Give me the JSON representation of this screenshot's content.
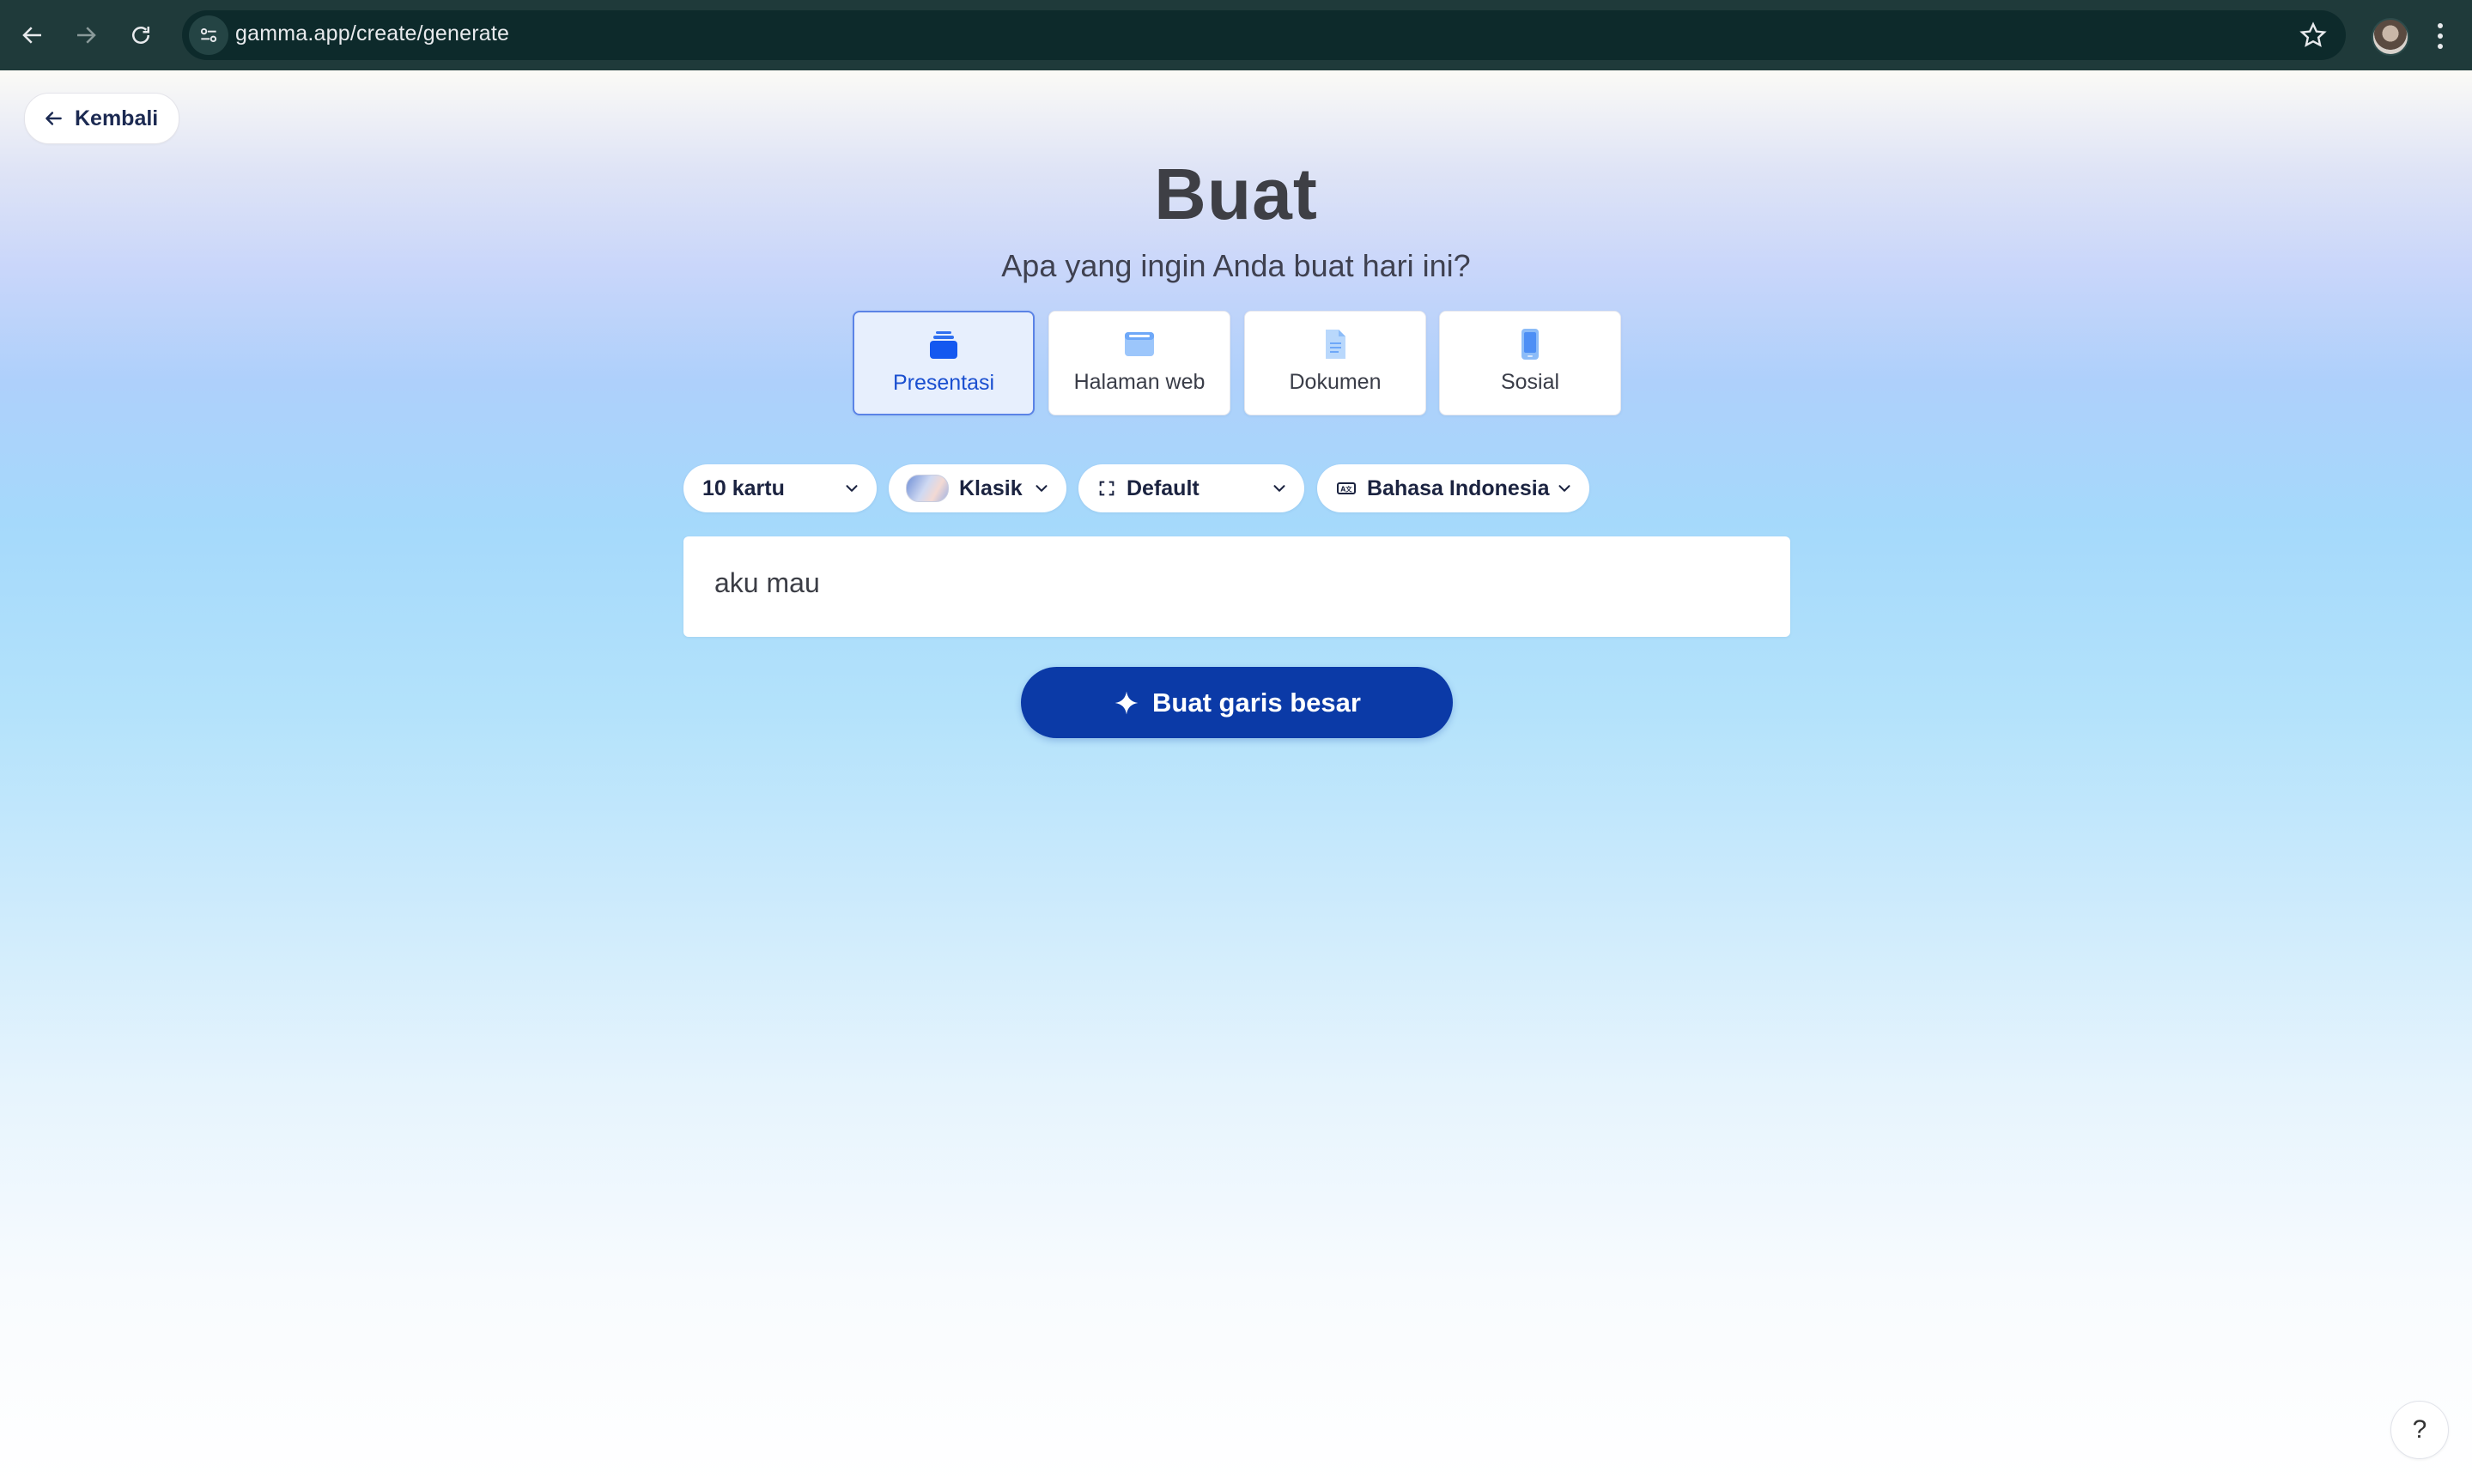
{
  "browser": {
    "url": "gamma.app/create/generate",
    "icons": [
      "back-arrow-icon",
      "forward-arrow-icon",
      "reload-icon",
      "site-settings-icon",
      "bookmark-star-icon",
      "profile-avatar",
      "more-menu-icon"
    ]
  },
  "header": {
    "back_label": "Kembali"
  },
  "main": {
    "title": "Buat",
    "subtitle": "Apa yang ingin Anda buat hari ini?",
    "types": [
      {
        "label": "Presentasi",
        "icon": "stack-cards-icon",
        "selected": true
      },
      {
        "label": "Halaman web",
        "icon": "browser-window-icon",
        "selected": false
      },
      {
        "label": "Dokumen",
        "icon": "document-icon",
        "selected": false
      },
      {
        "label": "Sosial",
        "icon": "phone-icon",
        "selected": false
      }
    ],
    "options": {
      "cards": "10 kartu",
      "theme": "Klasik",
      "format": "Default",
      "language": "Bahasa Indonesia"
    },
    "prompt_value": "aku mau",
    "generate_label": "Buat garis besar"
  },
  "help_label": "?",
  "colors": {
    "accent": "#0b3aa7",
    "selected_card_bg": "#e7effd",
    "selected_card_border": "#5b83e6",
    "chrome_bg": "#1f3a3a"
  }
}
